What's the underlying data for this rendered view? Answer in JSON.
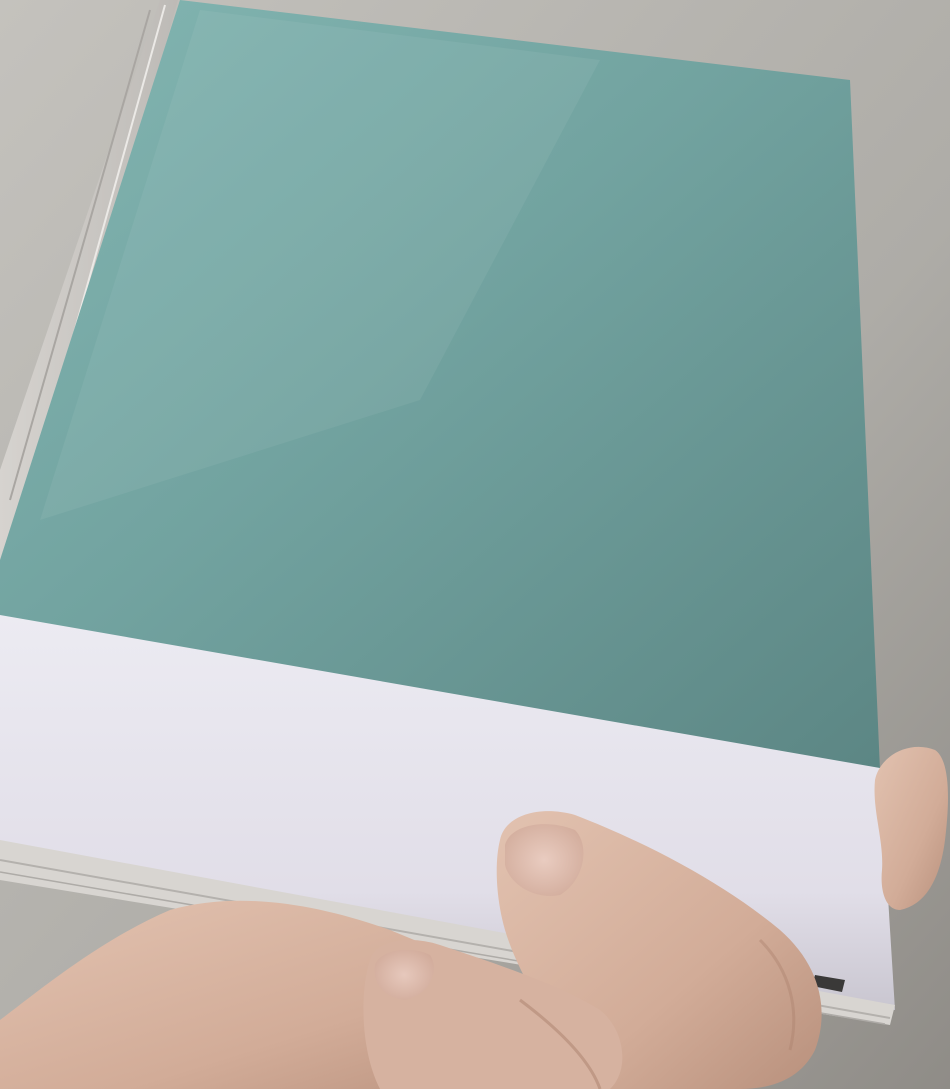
{
  "scene": {
    "subject": "notebook-held-in-hand",
    "colors": {
      "background": "#b9b7b2",
      "background_dark": "#8e8b86",
      "cover": "#6f9e9c",
      "cover_light": "#83b6b2",
      "cover_dark": "#5c8684",
      "band": "#e6e3ec",
      "band_shadow": "#c9c6d0",
      "page_edges": "#dcd9d6",
      "skin": "#d9b8a6",
      "skin_shadow": "#b8907c",
      "nail": "#e2c4ba"
    }
  }
}
